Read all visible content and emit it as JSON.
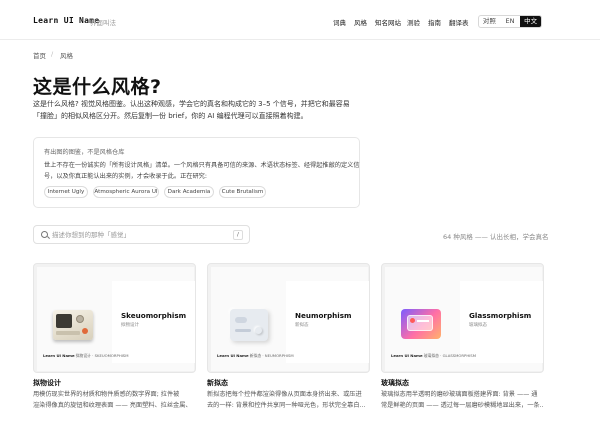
{
  "header": {
    "brand": "Learn UI Name",
    "brand_sub": "界面叫法",
    "nav": [
      "词典",
      "风格",
      "知名网站",
      "测验",
      "指南",
      "翻译表"
    ],
    "lang": {
      "light": "对照",
      "en": "EN",
      "zh": "中文",
      "active": "中文"
    }
  },
  "breadcrumb": {
    "home": "首页",
    "sep": "/",
    "current": "风格"
  },
  "page": {
    "title": "这是什么风格?",
    "lead_1": "这是什么风格? 视觉风格图鉴。认出这种观感，学会它的真名和构成它的 3–5 个信号，并把它和最容易",
    "lead_2": "「撞脸」的相似风格区分开。然后复制一份 brief，你的 AI 编程代理可以直接照着构建。"
  },
  "note": {
    "head": "有出图的图鉴，不是风格仓库",
    "line_1": "世上不存在一份诚实的「所有设计风格」清单。一个风格只有具备可信的来源、术语状态标签、经得起推敲的定义信",
    "line_2": "号，以及你真正能认出来的实例，才会收录于此。正在研究:",
    "chips": [
      "Internet Ugly",
      "Atmospheric Aurora UI",
      "Dark Academia",
      "Cute Brutalism"
    ]
  },
  "search": {
    "placeholder": "描述你想到的那种「感觉」",
    "shortcut": "/"
  },
  "count": "64 种风格 —— 认出长相，学会真名",
  "cards": [
    {
      "name": "Skeuomorphism",
      "tag": "拟物设计",
      "foot_brand": "Learn UI Name",
      "foot_text": "拟物设计 · SKEUOMORPHISM",
      "label": "拟物设计",
      "desc_1": "用模仿现实世界的材质和物件质感的数字界面; 拉件被",
      "desc_2": "渲染得像真的旋钮和纹理表面 —— 亮面塑料、拉丝金属、"
    },
    {
      "name": "Neumorphism",
      "tag": "新拟态",
      "foot_brand": "Learn UI Name",
      "foot_text": "新拟态 · NEUMORPHISM",
      "label": "新拟态",
      "desc_1": "新拟态把每个控件都渲染得像从页面本身挤出来、或压进",
      "desc_2": "去的一样: 背景和控件共享同一种哑光色，形状完全靠白..."
    },
    {
      "name": "Glassmorphism",
      "tag": "玻璃拟态",
      "foot_brand": "Learn UI Name",
      "foot_text": "玻璃拟态 · GLASSMORPHISM",
      "label": "玻璃拟态",
      "desc_1": "玻璃拟态用半透明的磨砂玻璃面板搭建界面: 背景 —— 通",
      "desc_2": "常是鲜艳的页面 —— 透过每一层磨砂模糊地显出来，一条..."
    }
  ]
}
